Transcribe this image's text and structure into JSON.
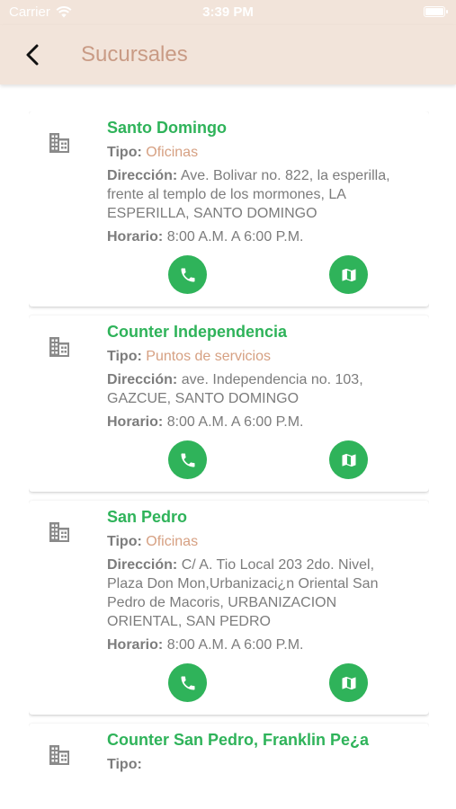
{
  "status_bar": {
    "carrier": "Carrier",
    "time": "3:39 PM"
  },
  "header": {
    "title": "Sucursales",
    "back_icon": "chevron-left-icon"
  },
  "labels": {
    "tipo": "Tipo:",
    "direccion": "Dirección:",
    "horario": "Horario:"
  },
  "colors": {
    "accent_green": "#2fb35a",
    "header_bg": "#f2e4da",
    "title_color": "#c99b85",
    "tipo_value": "#d6a082"
  },
  "branches": [
    {
      "name": "Santo Domingo",
      "tipo": "Oficinas",
      "direccion": "Ave. Bolivar no. 822, la esperilla, frente al templo de los mormones, LA ESPERILLA, SANTO DOMINGO",
      "horario": "8:00 A.M. A 6:00 P.M."
    },
    {
      "name": "Counter Independencia",
      "tipo": "Puntos de servicios",
      "direccion": "ave. Independencia no. 103, GAZCUE, SANTO DOMINGO",
      "horario": "8:00 A.M. A 6:00 P.M."
    },
    {
      "name": "San Pedro",
      "tipo": "Oficinas",
      "direccion": "C/ A. Tio Local 203 2do. Nivel, Plaza Don Mon,Urbanizaci¿n Oriental San Pedro de Macoris, URBANIZACION ORIENTAL, SAN PEDRO",
      "horario": "8:00 A.M. A 6:00 P.M."
    },
    {
      "name": "Counter San Pedro, Franklin Pe¿a",
      "tipo": "",
      "direccion": "",
      "horario": ""
    }
  ]
}
